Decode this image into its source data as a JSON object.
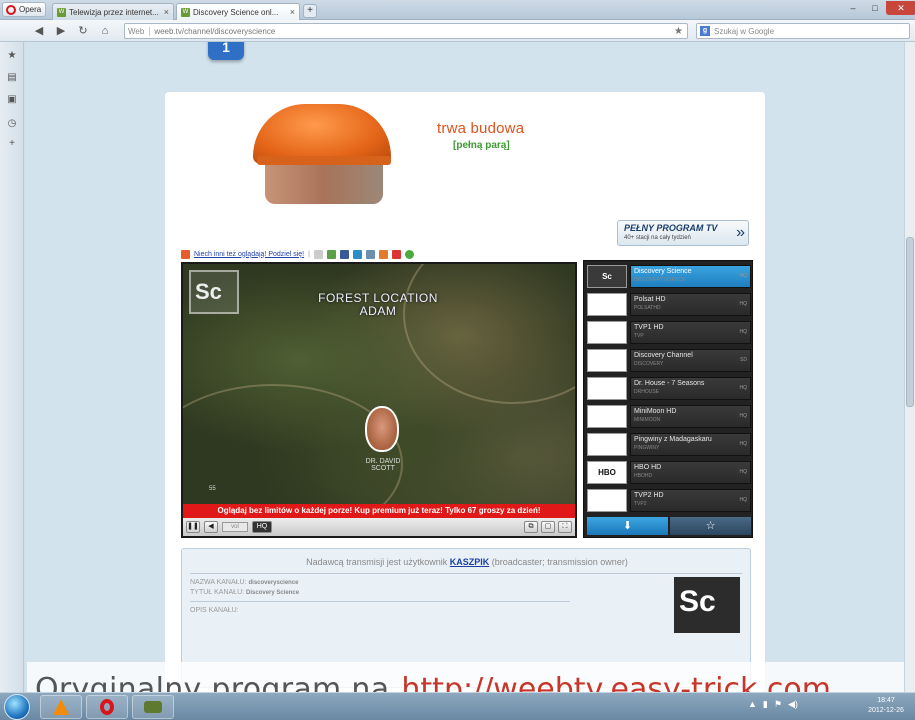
{
  "browser": {
    "menu_label": "Opera",
    "tabs": [
      {
        "label": "Telewizja przez internet...",
        "active": false
      },
      {
        "label": "Discovery Science onl...",
        "active": true
      }
    ],
    "url_prefix": "Web",
    "url": "weeb.tv/channel/discoveryscience",
    "search_placeholder": "Szukaj w Google"
  },
  "banner": {
    "title": "trwa budowa",
    "subtitle": "[pełną parą]"
  },
  "program_badge": {
    "title": "PEŁNY PROGRAM TV",
    "subtitle": "40+ stacji na cały tydzień"
  },
  "share": {
    "text": "Niech inni też oglądają! Podziel się!"
  },
  "video": {
    "corner_logo": "Sc",
    "caption_line1": "FOREST LOCATION",
    "caption_line2": "ADAM",
    "person_name": "DR. DAVID SCOTT",
    "timecode": "55",
    "promo_text": "Oglądaj bez limitów o każdej porze! Kup premium już teraz! Tylko 67 groszy za dzień!",
    "volume_label": "vol"
  },
  "channels": [
    {
      "thumb": "Sc",
      "name": "Discovery Science",
      "sub": "DISCOVERYSCIENCE",
      "q": "HQ",
      "active": true
    },
    {
      "thumb": "",
      "name": "Polsat HD",
      "sub": "POLSATHD",
      "q": "HQ",
      "active": false
    },
    {
      "thumb": "",
      "name": "TVP1 HD",
      "sub": "TVP",
      "q": "HQ",
      "active": false
    },
    {
      "thumb": "",
      "name": "Discovery Channel",
      "sub": "DISCOVERY",
      "q": "SD",
      "active": false
    },
    {
      "thumb": "",
      "name": "Dr. House - 7 Seasons",
      "sub": "DRHOUSE",
      "q": "HQ",
      "active": false
    },
    {
      "thumb": "",
      "name": "MiniMoon HD",
      "sub": "MINIMOON",
      "q": "HQ",
      "active": false
    },
    {
      "thumb": "",
      "name": "Pingwiny z Madagaskaru",
      "sub": "PINGWINY",
      "q": "HQ",
      "active": false
    },
    {
      "thumb": "HBO",
      "name": "HBO HD",
      "sub": "HBOHD",
      "q": "HQ",
      "active": false
    },
    {
      "thumb": "",
      "name": "TVP2 HD",
      "sub": "TVP2",
      "q": "HQ",
      "active": false
    }
  ],
  "info": {
    "owner_prefix": "Nadawcą transmisji jest użytkownik",
    "owner_user": "KASZPIK",
    "owner_suffix": "(broadcaster; transmission owner)",
    "rows": [
      {
        "label": "NAZWA KANAŁU:",
        "value": "discoveryscience"
      },
      {
        "label": "TYTUŁ KANAŁU:",
        "value": "Discovery Science"
      },
      {
        "label": "OPIS KANAŁU:",
        "value": ""
      }
    ],
    "channel_logo": "Sc"
  },
  "watermark": {
    "text": "Oryginalny program na",
    "url": "http://weebtv.easy-trick.com"
  },
  "taskbar": {
    "clock_time": "18:47",
    "clock_date": "2012-12-26"
  },
  "colors": {
    "accent_blue": "#1f7fc0",
    "promo_red": "#e01818",
    "banner_orange": "#e0521b",
    "banner_green": "#3f9a32"
  },
  "icons": [
    "back-icon",
    "forward-icon",
    "reload-icon",
    "home-icon",
    "star-icon",
    "google-icon",
    "bookmarks-icon",
    "notes-icon",
    "downloads-icon",
    "history-icon",
    "add-panel-icon",
    "start-orb-icon",
    "vlc-icon",
    "opera-icon",
    "volume-icon"
  ]
}
